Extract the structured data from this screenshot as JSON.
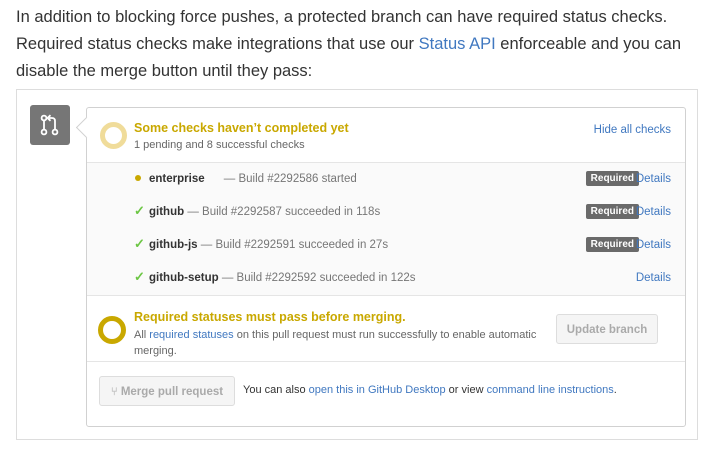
{
  "intro": {
    "line1": "In addition to blocking force pushes, a protected branch can have required status checks.",
    "line2_pre": "Required status checks make integrations that use our ",
    "line2_link": "Status API",
    "line2_post": " enforceable and you can",
    "line3": "disable the merge button until they pass:"
  },
  "header": {
    "title": "Some checks haven’t completed yet",
    "subtitle": "1 pending and 8 successful checks",
    "hide_link": "Hide all checks"
  },
  "checks": [
    {
      "name": "enterprise",
      "gap": "      ",
      "desc": "— Build #2292586 started",
      "state": "pending",
      "required_label": "Required",
      "details": "Details"
    },
    {
      "name": "github",
      "gap": " ",
      "desc": "— Build #2292587 succeeded in 118s",
      "state": "success",
      "required_label": "Required",
      "details": "Details"
    },
    {
      "name": "github-js",
      "gap": " ",
      "desc": "— Build #2292591 succeeded in 27s",
      "state": "success",
      "required_label": "Required",
      "details": "Details"
    },
    {
      "name": "github-setup",
      "gap": " ",
      "desc": "— Build #2292592 succeeded in 122s",
      "state": "success",
      "required_label": "",
      "details": "Details"
    }
  ],
  "merge_status": {
    "title": "Required statuses must pass before merging.",
    "text_pre": "All ",
    "text_link": "required statuses",
    "text_post": " on this pull request must run successfully to enable automatic merging.",
    "update_button": "Update branch"
  },
  "merge": {
    "button_label": "Merge pull request",
    "text_pre": "You can also ",
    "desktop_link": "open this in GitHub Desktop",
    "text_mid": " or view ",
    "cli_link": "command line instructions",
    "text_post": "."
  },
  "colors": {
    "pending": "#c9a800",
    "success": "#6cc644",
    "link": "#4078c0",
    "required_badge": "#6a6a6a"
  },
  "icons": {
    "pr": "git-pull-request-icon",
    "pending": "pending-dot-icon",
    "success": "check-icon",
    "merge": "git-merge-icon"
  }
}
